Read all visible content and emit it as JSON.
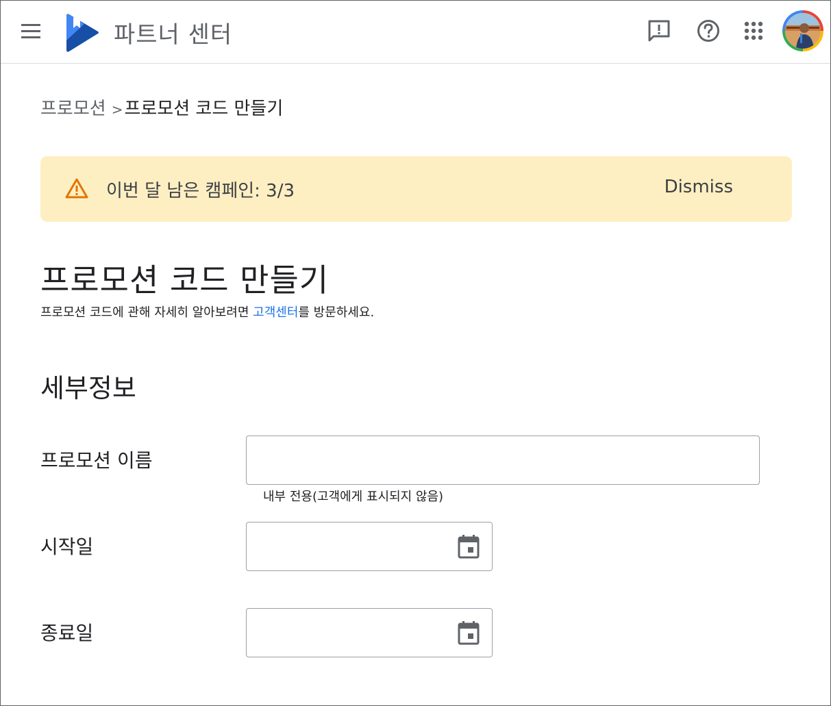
{
  "header": {
    "app_title": "파트너 센터",
    "icons": [
      "menu-icon",
      "play-books-logo",
      "feedback-icon",
      "help-icon",
      "apps-grid-icon",
      "account-avatar"
    ]
  },
  "breadcrumb": {
    "parent": "프로모션",
    "separator": ">",
    "current": "프로모션 코드 만들기"
  },
  "banner": {
    "message": "이번 달 남은 캠페인: 3/3",
    "dismiss_label": "Dismiss",
    "background": "#feefc3",
    "icon_color": "#e37400"
  },
  "page": {
    "title": "프로모션 코드 만들기",
    "subtitle_before": "프로모션 코드에 관해 자세히 알아보려면 ",
    "subtitle_link": "고객센터",
    "subtitle_after": "를 방문하세요."
  },
  "details": {
    "section_title": "세부정보",
    "promo_name_label": "프로모션 이름",
    "promo_name_value": "",
    "promo_name_helper": "내부 전용(고객에게 표시되지 않음)",
    "start_date_label": "시작일",
    "start_date_value": "",
    "end_date_label": "종료일",
    "end_date_value": ""
  },
  "colors": {
    "link": "#1a73e8",
    "logo_blue": "#4285f4",
    "logo_dark": "#174ea6"
  }
}
